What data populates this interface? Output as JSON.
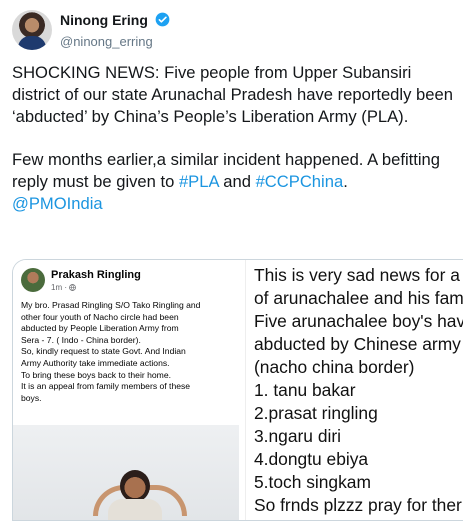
{
  "tweet": {
    "author_name": "Ninong Ering",
    "author_handle": "@ninong_erring",
    "paragraph1": "SHOCKING NEWS: Five people from Upper Subansiri district of our state Arunachal Pradesh have reportedly been ‘abducted’ by China’s People’s Liberation Army (PLA).",
    "paragraph2_prefix": "Few months earlier,a similar incident happened. A befitting reply must be given to ",
    "hashtag1": "#PLA",
    "and_text": " and ",
    "hashtag2": "#CCPChina",
    "period": ".",
    "mention": "@PMOIndia"
  },
  "media": {
    "fb_post": {
      "name": "Prakash Ringling",
      "meta": "1m · ",
      "body_lines": [
        "My bro. Prasad Ringling S/O Tako Ringling and",
        "other four youth of Nacho circle had been",
        "abducted by People Liberation Army from",
        "Sera - 7. ( Indo - China border).",
        "So, kindly request to state Govt. And Indian",
        "Army Authority take immediate actions.",
        "To bring these boys back to their home.",
        "It is an appeal from family members of these",
        "boys."
      ]
    },
    "note_lines": [
      "This is very sad news for a",
      "of arunachalee and his fam",
      " Five arunachalee boy's hav",
      "abducted by Chinese army",
      "(nacho china border)",
      "1. tanu bakar",
      "2.prasat ringling",
      "3.ngaru diri",
      "4.dongtu ebiya",
      "5.toch singkam",
      "So frnds plzzz pray for ther"
    ]
  },
  "icons": {
    "verified": "verified-badge-icon",
    "globe": "globe-icon"
  },
  "colors": {
    "link": "#1b95e0",
    "text": "#14171a",
    "secondary": "#657786",
    "verified": "#1da1f2"
  }
}
